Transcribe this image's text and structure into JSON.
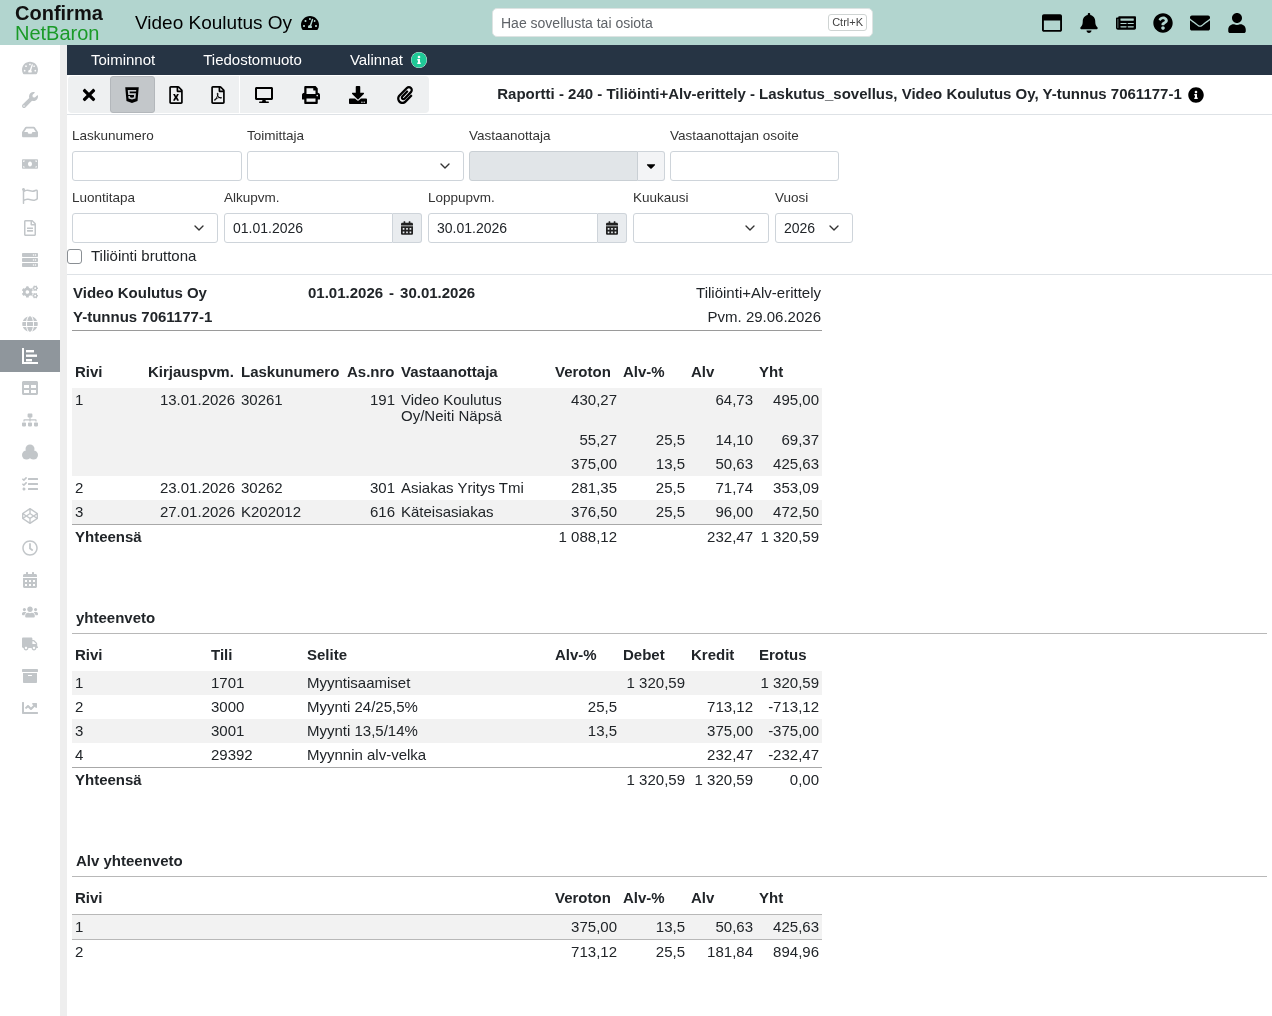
{
  "header": {
    "logo": {
      "top": "Confirma",
      "bottom": "NetBaron"
    },
    "company": "Video Koulutus Oy",
    "search": {
      "placeholder": "Hae sovellusta tai osiota",
      "shortcut": "Ctrl+K"
    }
  },
  "sidebar": {
    "items": [
      {
        "selected": false
      },
      {
        "selected": false
      },
      {
        "selected": false
      },
      {
        "selected": false
      },
      {
        "selected": false
      },
      {
        "selected": false
      },
      {
        "selected": false
      },
      {
        "selected": false
      },
      {
        "selected": false
      },
      {
        "selected": true
      },
      {
        "selected": false
      },
      {
        "selected": false
      },
      {
        "selected": false
      },
      {
        "selected": false
      },
      {
        "selected": false
      },
      {
        "selected": false
      },
      {
        "selected": false
      },
      {
        "selected": false
      },
      {
        "selected": false
      },
      {
        "selected": false
      },
      {
        "selected": false
      }
    ]
  },
  "menu_bar": {
    "items": [
      {
        "label": "Toiminnot",
        "info": false
      },
      {
        "label": "Tiedostomuoto",
        "info": false
      },
      {
        "label": "Valinnat",
        "info": true
      }
    ]
  },
  "toolbar": {
    "buttons": [
      {
        "selected": false
      },
      {
        "selected": true
      },
      {
        "selected": false
      },
      {
        "selected": false
      },
      {
        "selected": false
      },
      {
        "selected": false
      },
      {
        "selected": false
      },
      {
        "selected": false
      }
    ]
  },
  "report_title": "Raportti - 240 - Tiliöinti+Alv-erittely - Laskutus_sovellus, Video Koulutus Oy, Y-tunnus 7061177-1",
  "filters": {
    "rows": [
      {
        "fields": [
          {
            "label": "Laskunumero",
            "kind": "text",
            "disabled": false
          },
          {
            "label": "Toimittaja",
            "kind": "select",
            "disabled": false
          },
          {
            "label": "Vastaanottaja",
            "kind": "combo",
            "disabled": true
          },
          {
            "label": "Vastaanottajan osoite",
            "kind": "text",
            "disabled": false
          }
        ]
      },
      {
        "fields": [
          {
            "label": "Luontitapa",
            "kind": "select",
            "disabled": false
          },
          {
            "label": "Alkupvm.",
            "kind": "date",
            "value": "01.01.2026",
            "disabled": false
          },
          {
            "label": "Loppupvm.",
            "kind": "date",
            "value": "30.01.2026",
            "disabled": false
          },
          {
            "label": "Kuukausi",
            "kind": "select",
            "disabled": false
          },
          {
            "label": "Vuosi",
            "kind": "select",
            "value": "2026",
            "disabled": false
          }
        ]
      }
    ],
    "checkbox": {
      "label": "Tiliöinti bruttona",
      "checked": false
    }
  },
  "report_header": {
    "company": "Video Koulutus Oy",
    "business_id": "Y-tunnus 7061177-1",
    "period_start": "01.01.2026",
    "period_separator": "-",
    "period_end": "30.01.2026",
    "report_name": "Tiliöinti+Alv-erittely",
    "date": "Pvm. 29.06.2026"
  },
  "invoice_table": {
    "columns": [
      "Rivi",
      "Kirjauspvm.",
      "Laskunumero",
      "As.nro",
      "Vastaanottaja",
      "Veroton",
      "Alv-%",
      "Alv",
      "Yht"
    ],
    "rows": [
      {
        "row": "1",
        "posting_date": "13.01.2026",
        "invoice_no": "30261",
        "customer_no": "191",
        "recipient": "Video Koulutus Oy/Neiti Näpsä",
        "net": "430,27",
        "vat": "64,73",
        "total": "495,00",
        "lines": [
          {
            "net": "55,27",
            "vat_rate": "25,5",
            "vat": "14,10",
            "total": "69,37"
          },
          {
            "net": "375,00",
            "vat_rate": "13,5",
            "vat": "50,63",
            "total": "425,63"
          }
        ]
      },
      {
        "row": "2",
        "posting_date": "23.01.2026",
        "invoice_no": "30262",
        "customer_no": "301",
        "recipient": "Asiakas Yritys Tmi",
        "net": "281,35",
        "vat_rate": "25,5",
        "vat": "71,74",
        "total": "353,09"
      },
      {
        "row": "3",
        "posting_date": "27.01.2026",
        "invoice_no": "K202012",
        "customer_no": "616",
        "recipient": "Käteisasiakas",
        "net": "376,50",
        "vat_rate": "25,5",
        "vat": "96,00",
        "total": "472,50"
      }
    ],
    "totals": {
      "label": "Yhteensä",
      "net": "1 088,12",
      "vat": "232,47",
      "total": "1 320,59"
    }
  },
  "summary": {
    "title": "yhteenveto",
    "columns": [
      "Rivi",
      "Tili",
      "Selite",
      "Alv-%",
      "Debet",
      "Kredit",
      "Erotus"
    ],
    "rows": [
      {
        "row": "1",
        "account": "1701",
        "description": "Myyntisaamiset",
        "debit": "1 320,59",
        "balance": "1 320,59"
      },
      {
        "row": "2",
        "account": "3000",
        "description": "Myynti 24/25,5%",
        "vat_rate": "25,5",
        "credit": "713,12",
        "balance": "-713,12"
      },
      {
        "row": "3",
        "account": "3001",
        "description": "Myynti 13,5/14%",
        "vat_rate": "13,5",
        "credit": "375,00",
        "balance": "-375,00"
      },
      {
        "row": "4",
        "account": "29392",
        "description": "Myynnin alv-velka",
        "credit": "232,47",
        "balance": "-232,47"
      }
    ],
    "totals": {
      "label": "Yhteensä",
      "debit": "1 320,59",
      "credit": "1 320,59",
      "balance": "0,00"
    }
  },
  "vat_summary": {
    "title": "Alv yhteenveto",
    "columns": [
      "Rivi",
      "Veroton",
      "Alv-%",
      "Alv",
      "Yht"
    ],
    "rows": [
      {
        "row": "1",
        "net": "375,00",
        "vat_rate": "13,5",
        "vat": "50,63",
        "total": "425,63"
      },
      {
        "row": "2",
        "net": "713,12",
        "vat_rate": "25,5",
        "vat": "181,84",
        "total": "894,96"
      }
    ]
  }
}
